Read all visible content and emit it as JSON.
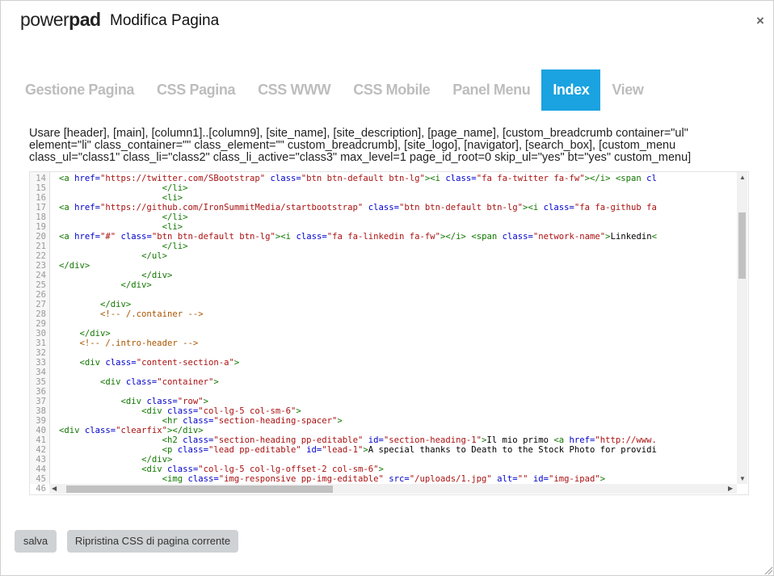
{
  "header": {
    "brand_light": "power",
    "brand_bold": "pad",
    "title": "Modifica Pagina",
    "close_label": "×"
  },
  "tabs": [
    {
      "label": "Gestione Pagina",
      "active": false
    },
    {
      "label": "CSS Pagina",
      "active": false
    },
    {
      "label": "CSS WWW",
      "active": false
    },
    {
      "label": "CSS Mobile",
      "active": false
    },
    {
      "label": "Panel Menu",
      "active": false
    },
    {
      "label": "Index",
      "active": true
    },
    {
      "label": "View",
      "active": false
    }
  ],
  "help_text": "Usare [header], [main], [column1]..[column9], [site_name], [site_description], [page_name], [custom_breadcrumb container=\"ul\" element=\"li\" class_container=\"\" class_element=\"\" custom_breadcrumb], [site_logo], [navigator], [search_box], [custom_menu class_ul=\"class1\" class_li=\"class2\" class_li_active=\"class3\" max_level=1 page_id_root=0 skip_ul=\"yes\" bt=\"yes\" custom_menu]",
  "editor": {
    "lines": [
      {
        "n": "14",
        "segs": [
          [
            "t",
            "<a "
          ],
          [
            "a",
            "href="
          ],
          [
            "s",
            "\"https://twitter.com/SBootstrap\""
          ],
          [
            "a",
            " class="
          ],
          [
            "s",
            "\"btn btn-default btn-lg\""
          ],
          [
            "t",
            ">"
          ],
          [
            "t",
            "<i "
          ],
          [
            "a",
            "class="
          ],
          [
            "s",
            "\"fa fa-twitter fa-fw\""
          ],
          [
            "t",
            "></i>"
          ],
          [
            "t",
            " <span "
          ],
          [
            "a",
            "cl"
          ]
        ]
      },
      {
        "n": "15",
        "segs": [
          [
            "x",
            "                    "
          ],
          [
            "t",
            "</li>"
          ]
        ]
      },
      {
        "n": "16",
        "segs": [
          [
            "x",
            "                    "
          ],
          [
            "t",
            "<li>"
          ]
        ]
      },
      {
        "n": "17",
        "segs": [
          [
            "t",
            "<a "
          ],
          [
            "a",
            "href="
          ],
          [
            "s",
            "\"https://github.com/IronSummitMedia/startbootstrap\""
          ],
          [
            "a",
            " class="
          ],
          [
            "s",
            "\"btn btn-default btn-lg\""
          ],
          [
            "t",
            ">"
          ],
          [
            "t",
            "<i "
          ],
          [
            "a",
            "class="
          ],
          [
            "s",
            "\"fa fa-github fa"
          ]
        ]
      },
      {
        "n": "18",
        "segs": [
          [
            "x",
            "                    "
          ],
          [
            "t",
            "</li>"
          ]
        ]
      },
      {
        "n": "19",
        "segs": [
          [
            "x",
            "                    "
          ],
          [
            "t",
            "<li>"
          ]
        ]
      },
      {
        "n": "20",
        "segs": [
          [
            "t",
            "<a "
          ],
          [
            "a",
            "href="
          ],
          [
            "s",
            "\"#\""
          ],
          [
            "a",
            " class="
          ],
          [
            "s",
            "\"btn btn-default btn-lg\""
          ],
          [
            "t",
            ">"
          ],
          [
            "t",
            "<i "
          ],
          [
            "a",
            "class="
          ],
          [
            "s",
            "\"fa fa-linkedin fa-fw\""
          ],
          [
            "t",
            "></i>"
          ],
          [
            "t",
            " <span "
          ],
          [
            "a",
            "class="
          ],
          [
            "s",
            "\"network-name\""
          ],
          [
            "t",
            ">"
          ],
          [
            "x",
            "Linkedin"
          ],
          [
            "t",
            "<"
          ]
        ]
      },
      {
        "n": "21",
        "segs": [
          [
            "x",
            "                    "
          ],
          [
            "t",
            "</li>"
          ]
        ]
      },
      {
        "n": "22",
        "segs": [
          [
            "x",
            "                "
          ],
          [
            "t",
            "</ul>"
          ]
        ]
      },
      {
        "n": "23",
        "segs": [
          [
            "t",
            "</div>"
          ]
        ]
      },
      {
        "n": "24",
        "segs": [
          [
            "x",
            "                "
          ],
          [
            "t",
            "</div>"
          ]
        ]
      },
      {
        "n": "25",
        "segs": [
          [
            "x",
            "            "
          ],
          [
            "t",
            "</div>"
          ]
        ]
      },
      {
        "n": "26",
        "segs": []
      },
      {
        "n": "27",
        "segs": [
          [
            "x",
            "        "
          ],
          [
            "t",
            "</div>"
          ]
        ]
      },
      {
        "n": "28",
        "segs": [
          [
            "x",
            "        "
          ],
          [
            "c",
            "<!-- /.container -->"
          ]
        ]
      },
      {
        "n": "29",
        "segs": []
      },
      {
        "n": "30",
        "segs": [
          [
            "x",
            "    "
          ],
          [
            "t",
            "</div>"
          ]
        ]
      },
      {
        "n": "31",
        "segs": [
          [
            "x",
            "    "
          ],
          [
            "c",
            "<!-- /.intro-header -->"
          ]
        ]
      },
      {
        "n": "32",
        "segs": []
      },
      {
        "n": "33",
        "segs": [
          [
            "x",
            "    "
          ],
          [
            "t",
            "<div "
          ],
          [
            "a",
            "class="
          ],
          [
            "s",
            "\"content-section-a\""
          ],
          [
            "t",
            ">"
          ]
        ]
      },
      {
        "n": "34",
        "segs": []
      },
      {
        "n": "35",
        "segs": [
          [
            "x",
            "        "
          ],
          [
            "t",
            "<div "
          ],
          [
            "a",
            "class="
          ],
          [
            "s",
            "\"container\""
          ],
          [
            "t",
            ">"
          ]
        ]
      },
      {
        "n": "36",
        "segs": []
      },
      {
        "n": "37",
        "segs": [
          [
            "x",
            "            "
          ],
          [
            "t",
            "<div "
          ],
          [
            "a",
            "class="
          ],
          [
            "s",
            "\"row\""
          ],
          [
            "t",
            ">"
          ]
        ]
      },
      {
        "n": "38",
        "segs": [
          [
            "x",
            "                "
          ],
          [
            "t",
            "<div "
          ],
          [
            "a",
            "class="
          ],
          [
            "s",
            "\"col-lg-5 col-sm-6\""
          ],
          [
            "t",
            ">"
          ]
        ]
      },
      {
        "n": "39",
        "segs": [
          [
            "x",
            "                    "
          ],
          [
            "t",
            "<hr "
          ],
          [
            "a",
            "class="
          ],
          [
            "s",
            "\"section-heading-spacer\""
          ],
          [
            "t",
            ">"
          ]
        ]
      },
      {
        "n": "40",
        "segs": [
          [
            "t",
            "<div "
          ],
          [
            "a",
            "class="
          ],
          [
            "s",
            "\"clearfix\""
          ],
          [
            "t",
            "></div>"
          ]
        ]
      },
      {
        "n": "41",
        "segs": [
          [
            "x",
            "                    "
          ],
          [
            "t",
            "<h2 "
          ],
          [
            "a",
            "class="
          ],
          [
            "s",
            "\"section-heading pp-editable\""
          ],
          [
            "a",
            " id="
          ],
          [
            "s",
            "\"section-heading-1\""
          ],
          [
            "t",
            ">"
          ],
          [
            "x",
            "Il mio primo "
          ],
          [
            "t",
            "<a "
          ],
          [
            "a",
            "href="
          ],
          [
            "s",
            "\"http://www."
          ]
        ]
      },
      {
        "n": "42",
        "segs": [
          [
            "x",
            "                    "
          ],
          [
            "t",
            "<p "
          ],
          [
            "a",
            "class="
          ],
          [
            "s",
            "\"lead pp-editable\""
          ],
          [
            "a",
            " id="
          ],
          [
            "s",
            "\"lead-1\""
          ],
          [
            "t",
            ">"
          ],
          [
            "x",
            "A special thanks to Death to the Stock Photo for providi"
          ]
        ]
      },
      {
        "n": "43",
        "segs": [
          [
            "x",
            "                "
          ],
          [
            "t",
            "</div>"
          ]
        ]
      },
      {
        "n": "44",
        "segs": [
          [
            "x",
            "                "
          ],
          [
            "t",
            "<div "
          ],
          [
            "a",
            "class="
          ],
          [
            "s",
            "\"col-lg-5 col-lg-offset-2 col-sm-6\""
          ],
          [
            "t",
            ">"
          ]
        ]
      },
      {
        "n": "45",
        "segs": [
          [
            "x",
            "                    "
          ],
          [
            "t",
            "<img "
          ],
          [
            "a",
            "class="
          ],
          [
            "s",
            "\"img-responsive pp-img-editable\""
          ],
          [
            "a",
            " src="
          ],
          [
            "s",
            "\"/uploads/1.jpg\""
          ],
          [
            "a",
            " alt="
          ],
          [
            "s",
            "\"\""
          ],
          [
            "a",
            " id="
          ],
          [
            "s",
            "\"img-ipad\""
          ],
          [
            "t",
            ">"
          ]
        ]
      },
      {
        "n": "46",
        "segs": []
      }
    ]
  },
  "buttons": {
    "save_label": "salva",
    "restore_label": "Ripristina CSS di pagina corrente"
  }
}
